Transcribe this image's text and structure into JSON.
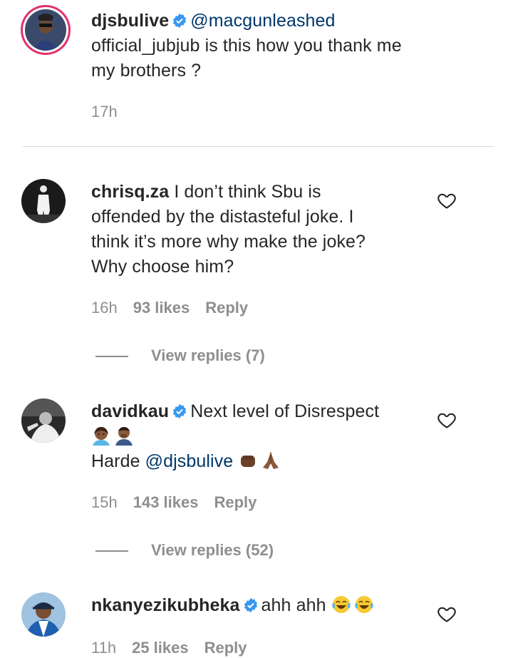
{
  "post": {
    "username": "djsbulive",
    "verified": true,
    "mention": "@macgunleashed",
    "text_line1": "official_jubjub is this how you thank me",
    "text_line2": "my brothers ?",
    "time": "17h"
  },
  "comments": [
    {
      "username": "chrisq.za",
      "verified": false,
      "text_first": "I don’t think Sbu is",
      "text_lines": [
        "offended by the distasteful joke. I",
        "think it’s more why make the joke?",
        "Why choose him?"
      ],
      "time": "16h",
      "likes": "93 likes",
      "reply": "Reply",
      "view_replies": "View replies (7)"
    },
    {
      "username": "davidkau",
      "verified": true,
      "text_first": "Next level of Disrespect",
      "emoji_line": [
        "woman-gesturing-icon",
        "facepalm-man-icon"
      ],
      "text_last_prefix": "Harde",
      "text_last_mention": "@djsbulive",
      "text_last_emojis": [
        "fist-icon",
        "praying-hands-icon"
      ],
      "time": "15h",
      "likes": "143 likes",
      "reply": "Reply",
      "view_replies": "View replies (52)"
    },
    {
      "username": "nkanyezikubheka",
      "verified": true,
      "text_first": "ahh ahh",
      "text_emojis": [
        "laughing-tears-icon",
        "laughing-tears-icon"
      ],
      "time": "11h",
      "likes": "25 likes",
      "reply": "Reply"
    }
  ],
  "colors": {
    "text": "#262626",
    "muted": "#8e8e8e",
    "mention": "#00376b",
    "verified": "#3897f0",
    "story_ring": "#e1306c"
  }
}
